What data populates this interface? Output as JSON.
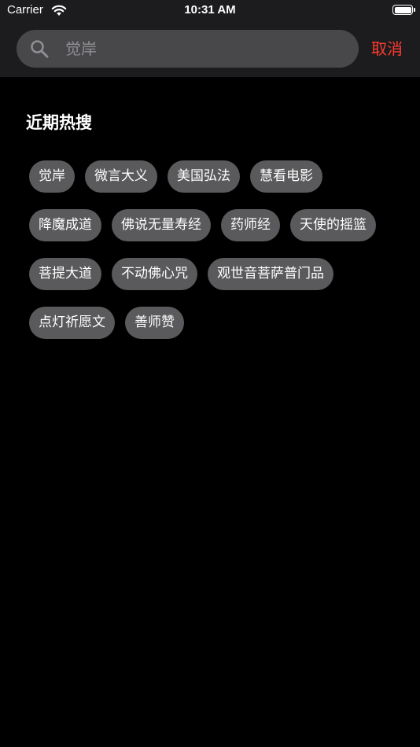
{
  "status_bar": {
    "carrier": "Carrier",
    "time": "10:31 AM"
  },
  "search": {
    "placeholder": "觉岸",
    "value": "",
    "cancel_label": "取消",
    "accent_color": "#ff3b30"
  },
  "hot_search": {
    "title": "近期热搜",
    "rows": [
      [
        "觉岸",
        "微言大义",
        "美国弘法",
        "慧看电影"
      ],
      [
        "降魔成道",
        "佛说无量寿经",
        "药师经",
        "天使的摇篮"
      ],
      [
        "菩提大道",
        "不动佛心咒",
        "观世音菩萨普门品"
      ],
      [
        "点灯祈愿文",
        "善师赞"
      ]
    ]
  }
}
